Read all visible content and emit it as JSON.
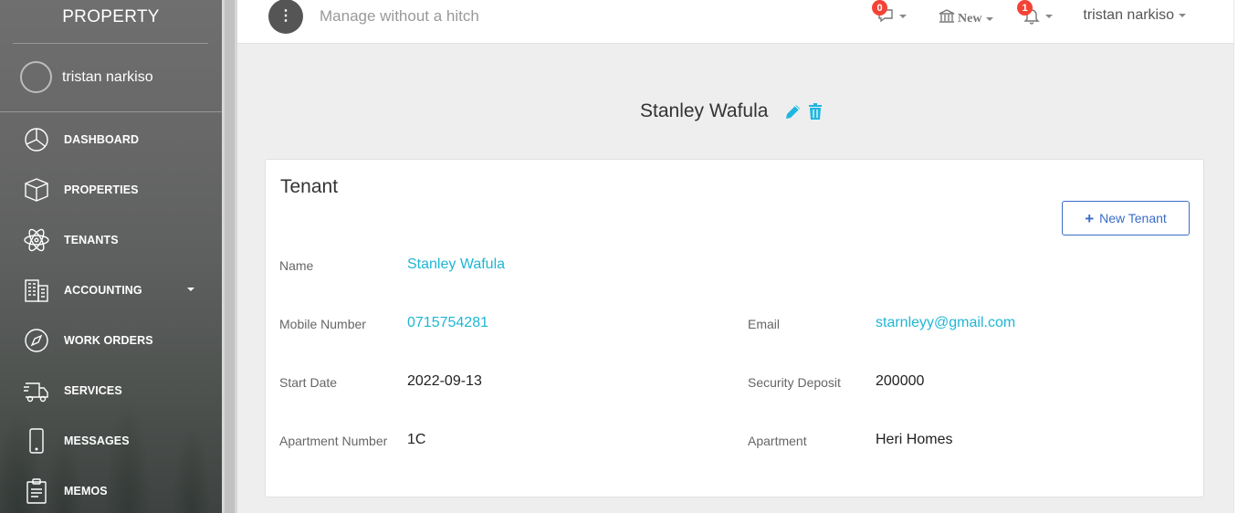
{
  "sidebar": {
    "brand": "PROPERTY",
    "user_name": "tristan narkiso",
    "items": [
      {
        "label": "DASHBOARD",
        "icon": "pie-chart-icon"
      },
      {
        "label": "PROPERTIES",
        "icon": "box-icon"
      },
      {
        "label": "TENANTS",
        "icon": "atom-icon"
      },
      {
        "label": "ACCOUNTING",
        "icon": "building-icon",
        "has_dropdown": true
      },
      {
        "label": "WORK ORDERS",
        "icon": "compass-icon"
      },
      {
        "label": "SERVICES",
        "icon": "delivery-truck-icon"
      },
      {
        "label": "MESSAGES",
        "icon": "mobile-icon"
      },
      {
        "label": "MEMOS",
        "icon": "clipboard-icon"
      }
    ]
  },
  "topbar": {
    "menu_icon": "vertical-dots-icon",
    "tagline": "Manage without a hitch",
    "messages_count": "0",
    "new_label": "New",
    "notifications_count": "1",
    "user_name": "tristan narkiso"
  },
  "page": {
    "tenant_name": "Stanley Wafula"
  },
  "card": {
    "title": "Tenant",
    "new_button_label": "New Tenant",
    "fields": {
      "name_label": "Name",
      "name_value": "Stanley Wafula",
      "mobile_label": "Mobile Number",
      "mobile_value": "0715754281",
      "email_label": "Email",
      "email_value": "starnleyy@gmail.com",
      "start_label": "Start Date",
      "start_value": "2022-09-13",
      "deposit_label": "Security Deposit",
      "deposit_value": "200000",
      "apt_num_label": "Apartment Number",
      "apt_num_value": "1C",
      "apt_label": "Apartment",
      "apt_value": "Heri Homes"
    }
  },
  "colors": {
    "accent_link": "#1fb6d4",
    "button_blue": "#3a6cc9",
    "badge_red": "#f44336"
  }
}
